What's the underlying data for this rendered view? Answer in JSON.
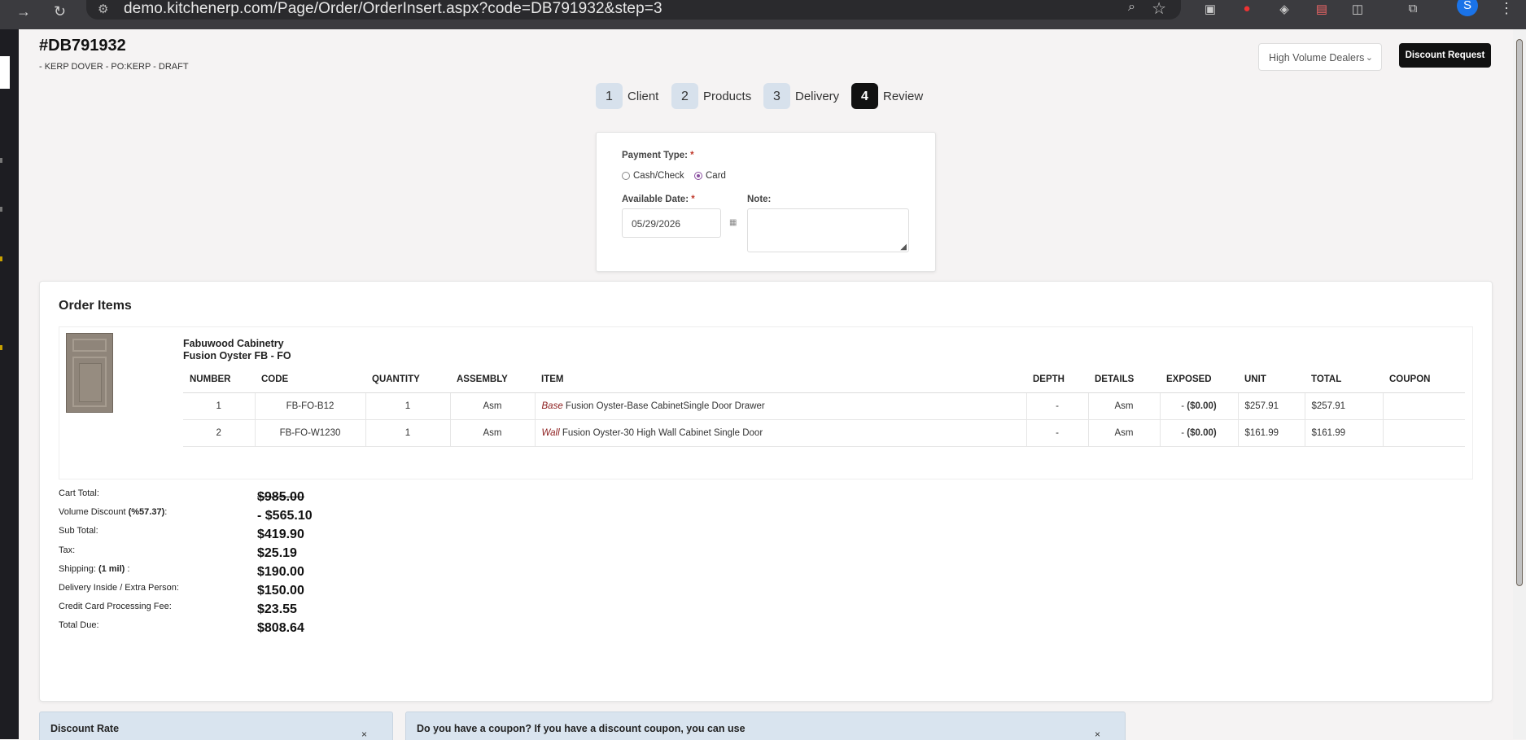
{
  "browser": {
    "url": "demo.kitchenerp.com/Page/Order/OrderInsert.aspx?code=DB791932&step=3",
    "avatar_letter": "S"
  },
  "header": {
    "order_code": "#DB791932",
    "order_subtitle": "- KERP DOVER - PO:KERP - DRAFT",
    "dealer_select": "High Volume Dealers",
    "discount_request_label": "Discount Request"
  },
  "steps": [
    {
      "num": "1",
      "label": "Client"
    },
    {
      "num": "2",
      "label": "Products"
    },
    {
      "num": "3",
      "label": "Delivery"
    },
    {
      "num": "4",
      "label": "Review"
    }
  ],
  "payment": {
    "type_label": "Payment Type:",
    "required_mark": "*",
    "options": [
      "Cash/Check",
      "Card"
    ],
    "selected": "Card",
    "date_label": "Available Date:",
    "date_value": "05/29/2026",
    "note_label": "Note:"
  },
  "order_items": {
    "title": "Order Items",
    "brand_line1": "Fabuwood Cabinetry",
    "brand_line2": "Fusion Oyster FB - FO",
    "columns": [
      "NUMBER",
      "CODE",
      "QUANTITY",
      "ASSEMBLY",
      "ITEM",
      "DEPTH",
      "DETAILS",
      "EXPOSED",
      "UNIT",
      "TOTAL",
      "COUPON"
    ],
    "rows": [
      {
        "number": "1",
        "code": "FB-FO-B12",
        "quantity": "1",
        "assembly": "Asm",
        "item_tag": "Base",
        "item_desc": "Fusion Oyster-Base CabinetSingle Door Drawer",
        "depth": "-",
        "details": "Asm",
        "exposed_prefix": "-",
        "exposed_value": "($0.00)",
        "unit": "$257.91",
        "total": "$257.91",
        "coupon": ""
      },
      {
        "number": "2",
        "code": "FB-FO-W1230",
        "quantity": "1",
        "assembly": "Asm",
        "item_tag": "Wall",
        "item_desc": "Fusion Oyster-30 High Wall Cabinet Single Door",
        "depth": "-",
        "details": "Asm",
        "exposed_prefix": "-",
        "exposed_value": "($0.00)",
        "unit": "$161.99",
        "total": "$161.99",
        "coupon": ""
      }
    ]
  },
  "totals": {
    "cart_total_label": "Cart Total:",
    "cart_total": "$985.00",
    "volume_discount_label": "Volume Discount",
    "volume_discount_pct": "(%57.37)",
    "volume_discount": "- $565.10",
    "sub_total_label": "Sub Total:",
    "sub_total": "$419.90",
    "tax_label": "Tax:",
    "tax": "$25.19",
    "shipping_label": "Shipping:",
    "shipping_detail": "(1 mil)",
    "shipping": "$190.00",
    "delivery_label": "Delivery Inside / Extra Person:",
    "delivery": "$150.00",
    "cc_fee_label": "Credit Card Processing Fee:",
    "cc_fee": "$23.55",
    "total_due_label": "Total Due:",
    "total_due": "$808.64"
  },
  "bottom": {
    "discount_rate_title": "Discount Rate",
    "coupon_title": "Do you have a coupon? If you have a discount coupon, you can use",
    "close_glyph": "×"
  },
  "colors": {
    "dark_button": "#111111",
    "step_bg": "#d7e1ec",
    "radio_accent": "#8a4fa0",
    "item_tag": "#8b1b1b",
    "bottom_box": "#d9e4ef"
  }
}
